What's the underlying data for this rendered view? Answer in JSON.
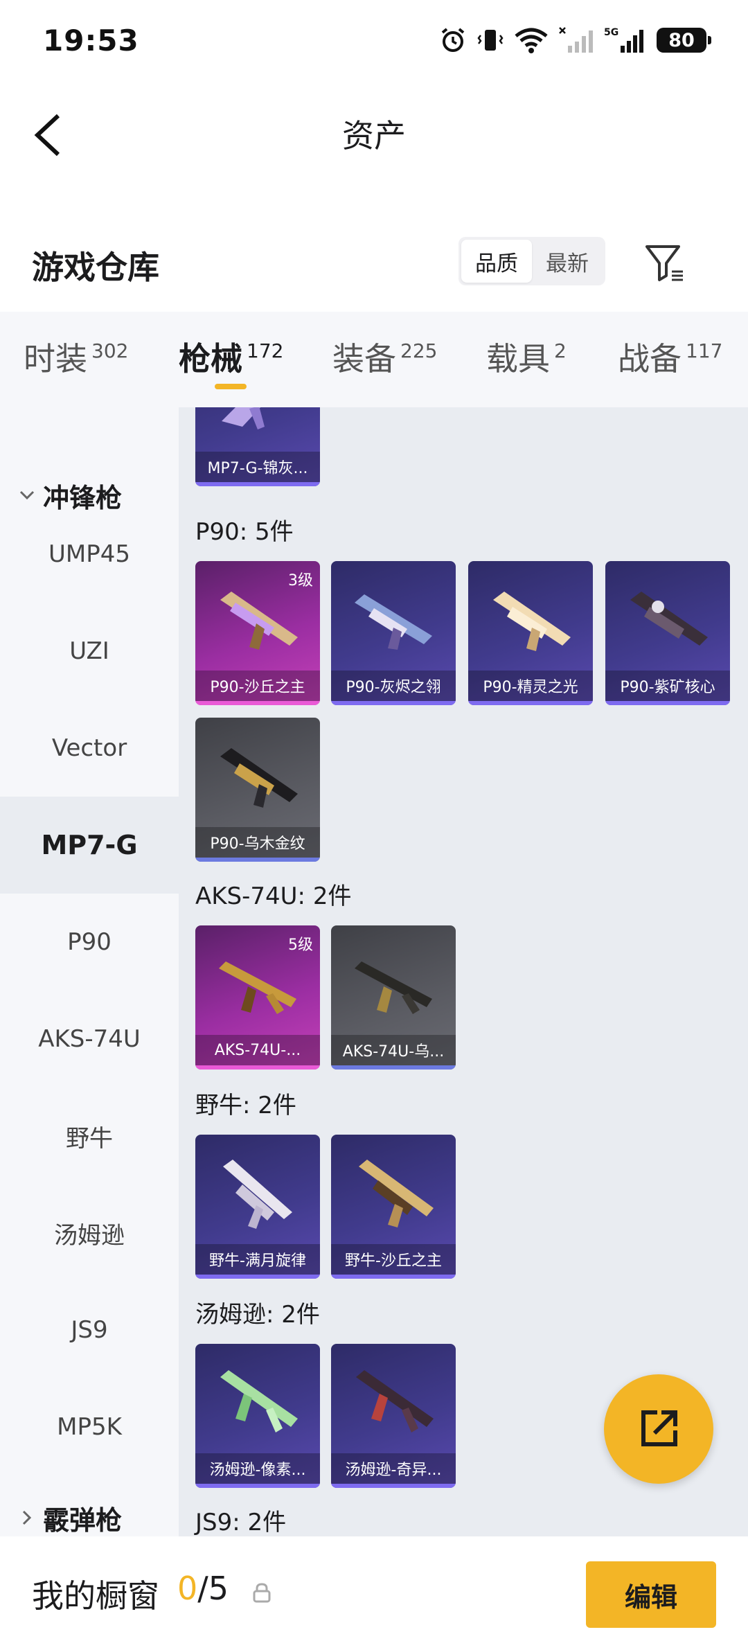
{
  "status": {
    "time": "19:53",
    "battery": "80",
    "network": "5G"
  },
  "nav": {
    "title": "资产"
  },
  "section": {
    "title": "游戏仓库",
    "sort_options": [
      "品质",
      "最新"
    ],
    "active_sort": "品质"
  },
  "tabs": [
    {
      "label": "时装",
      "count": "302"
    },
    {
      "label": "枪械",
      "count": "172"
    },
    {
      "label": "装备",
      "count": "225"
    },
    {
      "label": "载具",
      "count": "2"
    },
    {
      "label": "战备",
      "count": "117"
    }
  ],
  "active_tab": "枪械",
  "sidebar": {
    "group_open": "冲锋枪",
    "items": [
      "UMP45",
      "UZI",
      "Vector",
      "MP7-G",
      "P90",
      "AKS-74U",
      "野牛",
      "汤姆逊",
      "JS9",
      "MP5K"
    ],
    "selected": "MP7-G",
    "group_closed": "霰弹枪"
  },
  "content": {
    "top_card": {
      "name": "MP7-G-锦灰...",
      "rarity": "purple"
    },
    "groups": [
      {
        "title": "P90: 5件",
        "items": [
          {
            "name": "P90-沙丘之主",
            "rarity": "magenta",
            "level": "3级"
          },
          {
            "name": "P90-灰烬之翎",
            "rarity": "purple"
          },
          {
            "name": "P90-精灵之光",
            "rarity": "purple"
          },
          {
            "name": "P90-紫矿核心",
            "rarity": "purple"
          },
          {
            "name": "P90-乌木金纹",
            "rarity": "gray"
          }
        ]
      },
      {
        "title": "AKS-74U: 2件",
        "items": [
          {
            "name": "AKS-74U-...",
            "rarity": "magenta",
            "level": "5级"
          },
          {
            "name": "AKS-74U-乌...",
            "rarity": "gray"
          }
        ]
      },
      {
        "title": "野牛: 2件",
        "items": [
          {
            "name": "野牛-满月旋律",
            "rarity": "purple"
          },
          {
            "name": "野牛-沙丘之主",
            "rarity": "purple"
          }
        ]
      },
      {
        "title": "汤姆逊: 2件",
        "items": [
          {
            "name": "汤姆逊-像素...",
            "rarity": "purple"
          },
          {
            "name": "汤姆逊-奇异...",
            "rarity": "purple"
          }
        ]
      },
      {
        "title": "JS9: 2件",
        "items": []
      }
    ]
  },
  "bottom": {
    "showcase_label": "我的橱窗",
    "showcase_current": "0",
    "showcase_total": "/5",
    "edit_label": "编辑"
  },
  "colors": {
    "accent": "#f3b526",
    "rarity_purple": "#413b8d",
    "rarity_magenta": "#9b2ea2",
    "rarity_gray": "#5b5c63"
  }
}
